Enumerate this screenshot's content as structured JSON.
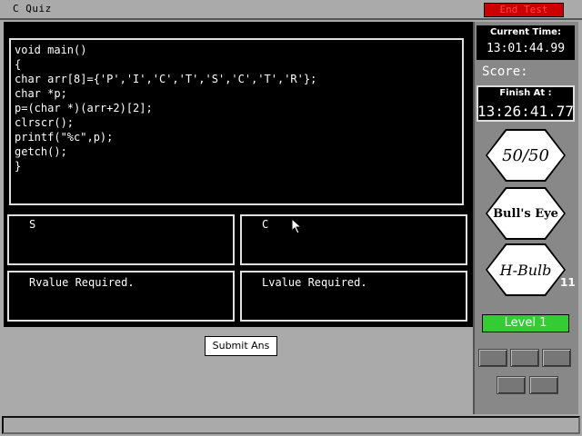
{
  "window": {
    "title": "C Quiz",
    "end_test_label": "End Test"
  },
  "code": {
    "lines": [
      "void main()",
      "{",
      "char arr[8]={'P','I','C','T','S','C','T','R'};",
      "char *p;",
      "p=(char *)(arr+2)[2];",
      "clrscr();",
      "printf(\"%c\",p);",
      "getch();",
      "}"
    ]
  },
  "options": [
    {
      "text": "S"
    },
    {
      "text": "C"
    },
    {
      "text": "Rvalue Required."
    },
    {
      "text": "Lvalue Required."
    }
  ],
  "submit_label": "Submit Ans",
  "sidebar": {
    "current_time_label": "Current Time:",
    "current_time": "13:01:44.99",
    "score_label": "Score:",
    "finish_at_label": "Finish At :",
    "finish_at": "13:26:41.77",
    "lifelines": [
      {
        "label": "50/50",
        "icon": "fifty-fifty-icon"
      },
      {
        "label": "Bull's Eye",
        "icon": "bulls-eye-icon"
      },
      {
        "label": "H-Bulb",
        "icon": "h-bulb-icon",
        "count": "11"
      }
    ],
    "level_label": "Level 1"
  },
  "colors": {
    "end_test": "#cc0000",
    "level": "#33cc33",
    "panel": "#000000",
    "chrome": "#aaaaaa"
  }
}
